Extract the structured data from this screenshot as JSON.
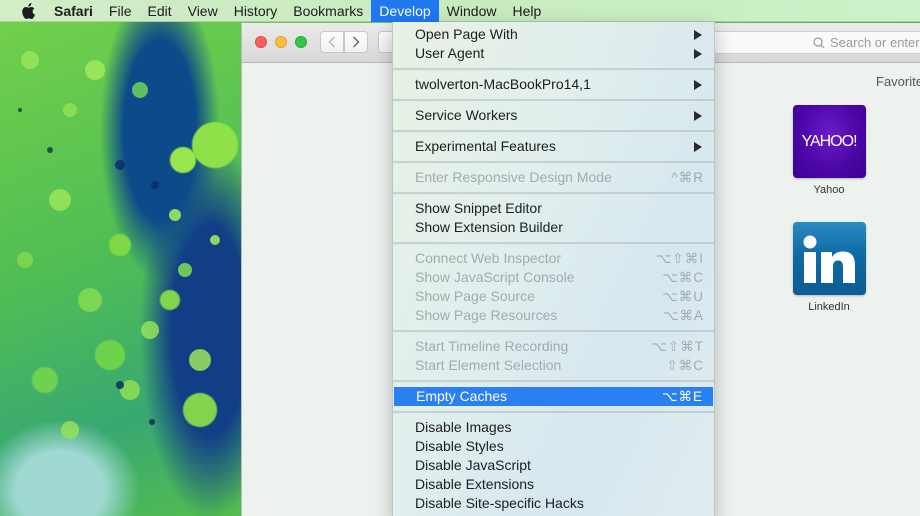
{
  "menubar": {
    "apple_icon": "apple-logo",
    "items": [
      {
        "label": "Safari",
        "bold": true
      },
      {
        "label": "File"
      },
      {
        "label": "Edit"
      },
      {
        "label": "View"
      },
      {
        "label": "History"
      },
      {
        "label": "Bookmarks"
      },
      {
        "label": "Develop",
        "active": true
      },
      {
        "label": "Window"
      },
      {
        "label": "Help"
      }
    ]
  },
  "safari": {
    "nav": {
      "back_icon": "chevron-left",
      "forward_icon": "chevron-right"
    },
    "address_placeholder": "Search or enter",
    "favorites_title": "Favorites",
    "favorites": [
      {
        "name": "Yahoo",
        "tile_text": "YAHOO!",
        "color": "#4d07a8"
      },
      {
        "name": "LinkedIn",
        "tile_text": "in",
        "color": "#0f6aa5"
      }
    ]
  },
  "develop_menu": {
    "highlight_color": "#2a7ff2",
    "groups": [
      [
        {
          "label": "Open Page With",
          "submenu": true
        },
        {
          "label": "User Agent",
          "submenu": true
        }
      ],
      [
        {
          "label": "twolverton-MacBookPro14,1",
          "submenu": true
        }
      ],
      [
        {
          "label": "Service Workers",
          "submenu": true
        }
      ],
      [
        {
          "label": "Experimental Features",
          "submenu": true
        }
      ],
      [
        {
          "label": "Enter Responsive Design Mode",
          "shortcut": "^⌘R",
          "disabled": true
        }
      ],
      [
        {
          "label": "Show Snippet Editor"
        },
        {
          "label": "Show Extension Builder"
        }
      ],
      [
        {
          "label": "Connect Web Inspector",
          "shortcut": "⌥⇧⌘I",
          "disabled": true
        },
        {
          "label": "Show JavaScript Console",
          "shortcut": "⌥⌘C",
          "disabled": true
        },
        {
          "label": "Show Page Source",
          "shortcut": "⌥⌘U",
          "disabled": true
        },
        {
          "label": "Show Page Resources",
          "shortcut": "⌥⌘A",
          "disabled": true
        }
      ],
      [
        {
          "label": "Start Timeline Recording",
          "shortcut": "⌥⇧⌘T",
          "disabled": true
        },
        {
          "label": "Start Element Selection",
          "shortcut": "⇧⌘C",
          "disabled": true
        }
      ],
      [
        {
          "label": "Empty Caches",
          "shortcut": "⌥⌘E",
          "highlighted": true
        }
      ],
      [
        {
          "label": "Disable Images"
        },
        {
          "label": "Disable Styles"
        },
        {
          "label": "Disable JavaScript"
        },
        {
          "label": "Disable Extensions"
        },
        {
          "label": "Disable Site-specific Hacks"
        }
      ]
    ]
  }
}
